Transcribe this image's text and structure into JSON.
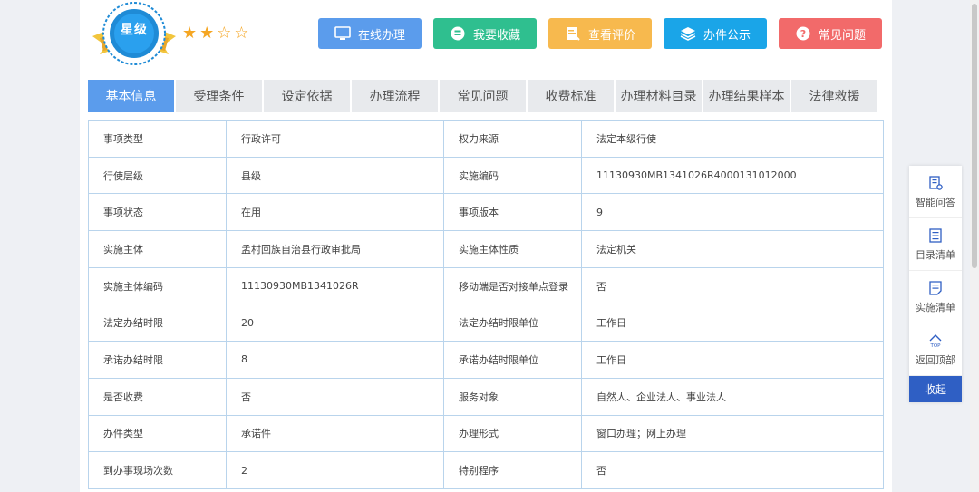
{
  "badge": {
    "label": "星级",
    "rating": 2,
    "max": 4
  },
  "actions": [
    {
      "label": "在线办理",
      "icon": "monitor-icon",
      "color": "#5b9cec"
    },
    {
      "label": "我要收藏",
      "icon": "collect-icon",
      "color": "#2fbf8f"
    },
    {
      "label": "查看评价",
      "icon": "review-icon",
      "color": "#f7b94e"
    },
    {
      "label": "办件公示",
      "icon": "layers-icon",
      "color": "#1aa5e8"
    },
    {
      "label": "常见问题",
      "icon": "question-icon",
      "color": "#f26a6a"
    }
  ],
  "tabs": [
    {
      "label": "基本信息",
      "active": true
    },
    {
      "label": "受理条件"
    },
    {
      "label": "设定依据"
    },
    {
      "label": "办理流程"
    },
    {
      "label": "常见问题"
    },
    {
      "label": "收费标准"
    },
    {
      "label": "办理材料目录"
    },
    {
      "label": "办理结果样本"
    },
    {
      "label": "法律救援"
    }
  ],
  "rows": [
    {
      "k1": "事项类型",
      "v1": "行政许可",
      "k2": "权力来源",
      "v2": "法定本级行使"
    },
    {
      "k1": "行使层级",
      "v1": "县级",
      "k2": "实施编码",
      "v2": "11130930MB1341026R4000131012000"
    },
    {
      "k1": "事项状态",
      "v1": "在用",
      "k2": "事项版本",
      "v2": "9"
    },
    {
      "k1": "实施主体",
      "v1": "孟村回族自治县行政审批局",
      "k2": "实施主体性质",
      "v2": "法定机关"
    },
    {
      "k1": "实施主体编码",
      "v1": "11130930MB1341026R",
      "k2": "移动端是否对接单点登录",
      "v2": "否"
    },
    {
      "k1": "法定办结时限",
      "v1": "20",
      "k2": "法定办结时限单位",
      "v2": "工作日"
    },
    {
      "k1": "承诺办结时限",
      "v1": "8",
      "k2": "承诺办结时限单位",
      "v2": "工作日"
    },
    {
      "k1": "是否收费",
      "v1": "否",
      "k2": "服务对象",
      "v2": "自然人、企业法人、事业法人"
    },
    {
      "k1": "办件类型",
      "v1": "承诺件",
      "k2": "办理形式",
      "v2": "窗口办理；网上办理"
    },
    {
      "k1": "到办事现场次数",
      "v1": "2",
      "k2": "特别程序",
      "v2": "否"
    }
  ],
  "float_menu": {
    "items": [
      {
        "label": "智能问答",
        "icon": "chat-doc-icon"
      },
      {
        "label": "目录清单",
        "icon": "list-icon"
      },
      {
        "label": "实施清单",
        "icon": "doc-icon"
      },
      {
        "label": "返回顶部",
        "icon": "top-icon",
        "sub": "TOP"
      }
    ],
    "collapse": "收起"
  }
}
